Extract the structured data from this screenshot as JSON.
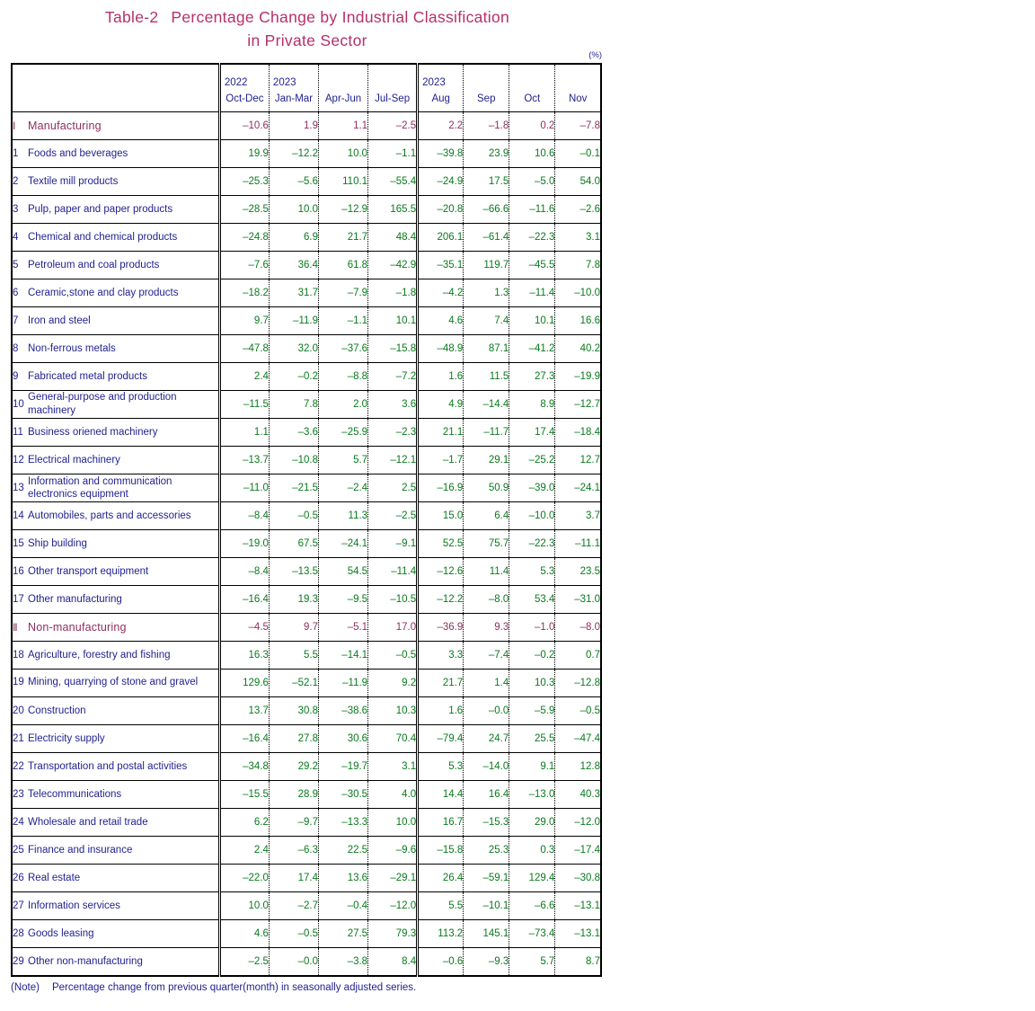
{
  "title": {
    "label": "Table-2",
    "line1": "Percentage Change by Industrial Classification",
    "line2": "in Private Sector"
  },
  "unit": "(%)",
  "note": {
    "tag": "(Note)",
    "text": "Percentage change from previous quarter(month) in seasonally adjusted series."
  },
  "colors": {
    "title": "#b5306b",
    "section": "#8e2f5e",
    "label": "#1f1f8f",
    "value": "#0a7a1e"
  },
  "header": {
    "row_label_blank": "",
    "columns": [
      {
        "year": "2022",
        "period": "Oct-Dec",
        "group": "quarter"
      },
      {
        "year": "2023",
        "period": "Jan-Mar",
        "group": "quarter"
      },
      {
        "year": "",
        "period": "Apr-Jun",
        "group": "quarter"
      },
      {
        "year": "",
        "period": "Jul-Sep",
        "group": "quarter"
      },
      {
        "year": "2023",
        "period": "Aug",
        "group": "month"
      },
      {
        "year": "",
        "period": "Sep",
        "group": "month"
      },
      {
        "year": "",
        "period": "Oct",
        "group": "month"
      },
      {
        "year": "",
        "period": "Nov",
        "group": "month"
      }
    ]
  },
  "chart_data": {
    "type": "table",
    "title": "Table-2 Percentage Change by Industrial Classification in Private Sector",
    "unit": "%",
    "categories": [
      "2022 Oct-Dec",
      "2023 Jan-Mar",
      "2023 Apr-Jun",
      "2023 Jul-Sep",
      "2023 Aug",
      "2023 Sep",
      "2023 Oct",
      "2023 Nov"
    ],
    "series": [
      {
        "name": "I Manufacturing",
        "values": [
          -10.6,
          1.9,
          1.1,
          -2.5,
          2.2,
          -1.8,
          0.2,
          -7.8
        ]
      },
      {
        "name": "1 Foods and beverages",
        "values": [
          19.9,
          -12.2,
          10.0,
          -1.1,
          -39.8,
          23.9,
          10.6,
          -0.1
        ]
      },
      {
        "name": "2 Textile mill products",
        "values": [
          -25.3,
          -5.6,
          110.1,
          -55.4,
          -24.9,
          17.5,
          -5.0,
          54.0
        ]
      },
      {
        "name": "3 Pulp, paper and paper products",
        "values": [
          -28.5,
          10.0,
          -12.9,
          165.5,
          -20.8,
          -66.6,
          -11.6,
          -2.6
        ]
      },
      {
        "name": "4 Chemical and chemical products",
        "values": [
          -24.8,
          6.9,
          21.7,
          48.4,
          206.1,
          -61.4,
          -22.3,
          3.1
        ]
      },
      {
        "name": "5 Petroleum and coal products",
        "values": [
          -7.6,
          36.4,
          61.8,
          -42.9,
          -35.1,
          119.7,
          -45.5,
          7.8
        ]
      },
      {
        "name": "6 Ceramic,stone and clay products",
        "values": [
          -18.2,
          31.7,
          -7.9,
          -1.8,
          -4.2,
          1.3,
          -11.4,
          -10.0
        ]
      },
      {
        "name": "7 Iron and steel",
        "values": [
          9.7,
          -11.9,
          -1.1,
          10.1,
          4.6,
          7.4,
          10.1,
          16.6
        ]
      },
      {
        "name": "8 Non-ferrous metals",
        "values": [
          -47.8,
          32.0,
          -37.6,
          -15.8,
          -48.9,
          87.1,
          -41.2,
          40.2
        ]
      },
      {
        "name": "9 Fabricated metal products",
        "values": [
          2.4,
          -0.2,
          -8.8,
          -7.2,
          1.6,
          11.5,
          27.3,
          -19.9
        ]
      },
      {
        "name": "10 General-purpose and production machinery",
        "values": [
          -11.5,
          7.8,
          2.0,
          3.6,
          4.9,
          -14.4,
          8.9,
          -12.7
        ]
      },
      {
        "name": "11 Business oriened machinery",
        "values": [
          1.1,
          -3.6,
          -25.9,
          -2.3,
          21.1,
          -11.7,
          17.4,
          -18.4
        ]
      },
      {
        "name": "12 Electrical machinery",
        "values": [
          -13.7,
          -10.8,
          5.7,
          -12.1,
          -1.7,
          29.1,
          -25.2,
          12.7
        ]
      },
      {
        "name": "13 Information and communication electronics equipment",
        "values": [
          -11.0,
          -21.5,
          -2.4,
          2.5,
          -16.9,
          50.9,
          -39.0,
          -24.1
        ]
      },
      {
        "name": "14 Automobiles, parts and accessories",
        "values": [
          -8.4,
          -0.5,
          11.3,
          -2.5,
          15.0,
          6.4,
          -10.0,
          3.7
        ]
      },
      {
        "name": "15 Ship building",
        "values": [
          -19.0,
          67.5,
          -24.1,
          -9.1,
          52.5,
          75.7,
          -22.3,
          -11.1
        ]
      },
      {
        "name": "16 Other transport equipment",
        "values": [
          -8.4,
          -13.5,
          54.5,
          -11.4,
          -12.6,
          11.4,
          5.3,
          23.5
        ]
      },
      {
        "name": "17 Other manufacturing",
        "values": [
          -16.4,
          19.3,
          -9.5,
          -10.5,
          -12.2,
          -8.0,
          53.4,
          -31.0
        ]
      },
      {
        "name": "II Non-manufacturing",
        "values": [
          -4.5,
          9.7,
          -5.1,
          17.0,
          -36.9,
          9.3,
          -1.0,
          -8.0
        ]
      },
      {
        "name": "18 Agriculture, forestry and fishing",
        "values": [
          16.3,
          5.5,
          -14.1,
          -0.5,
          3.3,
          -7.4,
          -0.2,
          0.7
        ]
      },
      {
        "name": "19 Mining, quarrying of stone and gravel",
        "values": [
          129.6,
          -52.1,
          -11.9,
          9.2,
          21.7,
          1.4,
          10.3,
          -12.8
        ]
      },
      {
        "name": "20 Construction",
        "values": [
          13.7,
          30.8,
          -38.6,
          10.3,
          1.6,
          -0.0,
          -5.9,
          -0.5
        ]
      },
      {
        "name": "21 Electricity supply",
        "values": [
          -16.4,
          27.8,
          30.6,
          70.4,
          -79.4,
          24.7,
          25.5,
          -47.4
        ]
      },
      {
        "name": "22 Transportation and postal activities",
        "values": [
          -34.8,
          29.2,
          -19.7,
          3.1,
          5.3,
          -14.0,
          9.1,
          12.8
        ]
      },
      {
        "name": "23 Telecommunications",
        "values": [
          -15.5,
          28.9,
          -30.5,
          4.0,
          14.4,
          16.4,
          -13.0,
          40.3
        ]
      },
      {
        "name": "24 Wholesale and retail trade",
        "values": [
          6.2,
          -9.7,
          -13.3,
          10.0,
          16.7,
          -15.3,
          29.0,
          -12.0
        ]
      },
      {
        "name": "25 Finance and insurance",
        "values": [
          2.4,
          -6.3,
          22.5,
          -9.6,
          -15.8,
          25.3,
          0.3,
          -17.4
        ]
      },
      {
        "name": "26 Real estate",
        "values": [
          -22.0,
          17.4,
          13.6,
          -29.1,
          26.4,
          -59.1,
          129.4,
          -30.8
        ]
      },
      {
        "name": "27 Information services",
        "values": [
          10.0,
          -2.7,
          -0.4,
          -12.0,
          5.5,
          -10.1,
          -6.6,
          -13.1
        ]
      },
      {
        "name": "28 Goods leasing",
        "values": [
          4.6,
          -0.5,
          27.5,
          79.3,
          113.2,
          145.1,
          -73.4,
          -13.1
        ]
      },
      {
        "name": "29 Other non-manufacturing",
        "values": [
          -2.5,
          -0.0,
          -3.8,
          8.4,
          -0.6,
          -9.3,
          5.7,
          8.7
        ]
      }
    ]
  },
  "rows": [
    {
      "kind": "section",
      "roman": "Ⅰ",
      "name": "Manufacturing",
      "values": [
        "–10.6",
        "1.9",
        "1.1",
        "–2.5",
        "2.2",
        "–1.8",
        "0.2",
        "–7.8"
      ]
    },
    {
      "kind": "item",
      "idx": "1",
      "name": "Foods and beverages",
      "lines": 1,
      "values": [
        "19.9",
        "–12.2",
        "10.0",
        "–1.1",
        "–39.8",
        "23.9",
        "10.6",
        "–0.1"
      ]
    },
    {
      "kind": "item",
      "idx": "2",
      "name": "Textile mill products",
      "lines": 1,
      "values": [
        "–25.3",
        "–5.6",
        "110.1",
        "–55.4",
        "–24.9",
        "17.5",
        "–5.0",
        "54.0"
      ]
    },
    {
      "kind": "item",
      "idx": "3",
      "name": "Pulp, paper and paper products",
      "lines": 1,
      "values": [
        "–28.5",
        "10.0",
        "–12.9",
        "165.5",
        "–20.8",
        "–66.6",
        "–11.6",
        "–2.6"
      ]
    },
    {
      "kind": "item",
      "idx": "4",
      "name": "Chemical and chemical products",
      "lines": 1,
      "values": [
        "–24.8",
        "6.9",
        "21.7",
        "48.4",
        "206.1",
        "–61.4",
        "–22.3",
        "3.1"
      ]
    },
    {
      "kind": "item",
      "idx": "5",
      "name": "Petroleum and coal products",
      "lines": 1,
      "values": [
        "–7.6",
        "36.4",
        "61.8",
        "–42.9",
        "–35.1",
        "119.7",
        "–45.5",
        "7.8"
      ]
    },
    {
      "kind": "item",
      "idx": "6",
      "name": "Ceramic,stone and clay products",
      "lines": 1,
      "values": [
        "–18.2",
        "31.7",
        "–7.9",
        "–1.8",
        "–4.2",
        "1.3",
        "–11.4",
        "–10.0"
      ]
    },
    {
      "kind": "item",
      "idx": "7",
      "name": "Iron and steel",
      "lines": 1,
      "values": [
        "9.7",
        "–11.9",
        "–1.1",
        "10.1",
        "4.6",
        "7.4",
        "10.1",
        "16.6"
      ]
    },
    {
      "kind": "item",
      "idx": "8",
      "name": "Non-ferrous metals",
      "lines": 1,
      "values": [
        "–47.8",
        "32.0",
        "–37.6",
        "–15.8",
        "–48.9",
        "87.1",
        "–41.2",
        "40.2"
      ]
    },
    {
      "kind": "item",
      "idx": "9",
      "name": "Fabricated metal products",
      "lines": 1,
      "values": [
        "2.4",
        "–0.2",
        "–8.8",
        "–7.2",
        "1.6",
        "11.5",
        "27.3",
        "–19.9"
      ]
    },
    {
      "kind": "item",
      "idx": "10",
      "name": "General-purpose and production machinery",
      "lines": 2,
      "values": [
        "–11.5",
        "7.8",
        "2.0",
        "3.6",
        "4.9",
        "–14.4",
        "8.9",
        "–12.7"
      ]
    },
    {
      "kind": "item",
      "idx": "11",
      "name": "Business oriened machinery",
      "lines": 1,
      "values": [
        "1.1",
        "–3.6",
        "–25.9",
        "–2.3",
        "21.1",
        "–11.7",
        "17.4",
        "–18.4"
      ]
    },
    {
      "kind": "item",
      "idx": "12",
      "name": "Electrical machinery",
      "lines": 1,
      "values": [
        "–13.7",
        "–10.8",
        "5.7",
        "–12.1",
        "–1.7",
        "29.1",
        "–25.2",
        "12.7"
      ]
    },
    {
      "kind": "item",
      "idx": "13",
      "name": "Information and communication electronics equipment",
      "lines": 2,
      "tight": true,
      "values": [
        "–11.0",
        "–21.5",
        "–2.4",
        "2.5",
        "–16.9",
        "50.9",
        "–39.0",
        "–24.1"
      ]
    },
    {
      "kind": "item",
      "idx": "14",
      "name": "Automobiles, parts and accessories",
      "lines": 2,
      "tight": true,
      "values": [
        "–8.4",
        "–0.5",
        "11.3",
        "–2.5",
        "15.0",
        "6.4",
        "–10.0",
        "3.7"
      ]
    },
    {
      "kind": "item",
      "idx": "15",
      "name": "Ship building",
      "lines": 1,
      "values": [
        "–19.0",
        "67.5",
        "–24.1",
        "–9.1",
        "52.5",
        "75.7",
        "–22.3",
        "–11.1"
      ]
    },
    {
      "kind": "item",
      "idx": "16",
      "name": "Other transport equipment",
      "lines": 1,
      "values": [
        "–8.4",
        "–13.5",
        "54.5",
        "–11.4",
        "–12.6",
        "11.4",
        "5.3",
        "23.5"
      ]
    },
    {
      "kind": "item",
      "idx": "17",
      "name": "Other manufacturing",
      "lines": 1,
      "values": [
        "–16.4",
        "19.3",
        "–9.5",
        "–10.5",
        "–12.2",
        "–8.0",
        "53.4",
        "–31.0"
      ]
    },
    {
      "kind": "section",
      "roman": "Ⅱ",
      "name": "Non-manufacturing",
      "values": [
        "–4.5",
        "9.7",
        "–5.1",
        "17.0",
        "–36.9",
        "9.3",
        "–1.0",
        "–8.0"
      ]
    },
    {
      "kind": "item",
      "idx": "18",
      "name": "Agriculture, forestry and fishing",
      "lines": 1,
      "values": [
        "16.3",
        "5.5",
        "–14.1",
        "–0.5",
        "3.3",
        "–7.4",
        "–0.2",
        "0.7"
      ]
    },
    {
      "kind": "item",
      "idx": "19",
      "name": "Mining, quarrying of stone and gravel",
      "lines": 2,
      "values": [
        "129.6",
        "–52.1",
        "–11.9",
        "9.2",
        "21.7",
        "1.4",
        "10.3",
        "–12.8"
      ]
    },
    {
      "kind": "item",
      "idx": "20",
      "name": "Construction",
      "lines": 1,
      "values": [
        "13.7",
        "30.8",
        "–38.6",
        "10.3",
        "1.6",
        "–0.0",
        "–5.9",
        "–0.5"
      ]
    },
    {
      "kind": "item",
      "idx": "21",
      "name": "Electricity supply",
      "lines": 1,
      "values": [
        "–16.4",
        "27.8",
        "30.6",
        "70.4",
        "–79.4",
        "24.7",
        "25.5",
        "–47.4"
      ]
    },
    {
      "kind": "item",
      "idx": "22",
      "name": "Transportation and postal activities",
      "lines": 1,
      "values": [
        "–34.8",
        "29.2",
        "–19.7",
        "3.1",
        "5.3",
        "–14.0",
        "9.1",
        "12.8"
      ]
    },
    {
      "kind": "item",
      "idx": "23",
      "name": "Telecommunications",
      "lines": 1,
      "values": [
        "–15.5",
        "28.9",
        "–30.5",
        "4.0",
        "14.4",
        "16.4",
        "–13.0",
        "40.3"
      ]
    },
    {
      "kind": "item",
      "idx": "24",
      "name": "Wholesale and retail trade",
      "lines": 1,
      "values": [
        "6.2",
        "–9.7",
        "–13.3",
        "10.0",
        "16.7",
        "–15.3",
        "29.0",
        "–12.0"
      ]
    },
    {
      "kind": "item",
      "idx": "25",
      "name": "Finance and insurance",
      "lines": 1,
      "values": [
        "2.4",
        "–6.3",
        "22.5",
        "–9.6",
        "–15.8",
        "25.3",
        "0.3",
        "–17.4"
      ]
    },
    {
      "kind": "item",
      "idx": "26",
      "name": "Real estate",
      "lines": 1,
      "values": [
        "–22.0",
        "17.4",
        "13.6",
        "–29.1",
        "26.4",
        "–59.1",
        "129.4",
        "–30.8"
      ]
    },
    {
      "kind": "item",
      "idx": "27",
      "name": "Information services",
      "lines": 1,
      "values": [
        "10.0",
        "–2.7",
        "–0.4",
        "–12.0",
        "5.5",
        "–10.1",
        "–6.6",
        "–13.1"
      ]
    },
    {
      "kind": "item",
      "idx": "28",
      "name": "Goods leasing",
      "lines": 1,
      "values": [
        "4.6",
        "–0.5",
        "27.5",
        "79.3",
        "113.2",
        "145.1",
        "–73.4",
        "–13.1"
      ]
    },
    {
      "kind": "item",
      "idx": "29",
      "name": "Other non-manufacturing",
      "lines": 1,
      "values": [
        "–2.5",
        "–0.0",
        "–3.8",
        "8.4",
        "–0.6",
        "–9.3",
        "5.7",
        "8.7"
      ]
    }
  ]
}
